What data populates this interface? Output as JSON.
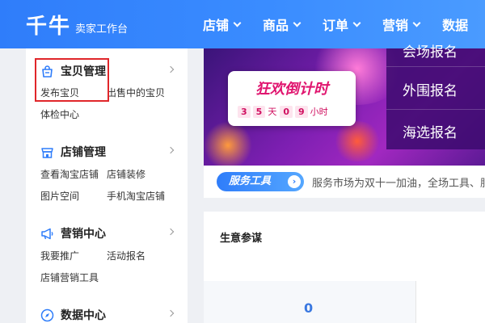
{
  "header": {
    "logo": "千牛",
    "subtitle": "卖家工作台",
    "nav": [
      {
        "label": "店铺"
      },
      {
        "label": "商品"
      },
      {
        "label": "订单"
      },
      {
        "label": "营销"
      },
      {
        "label": "数据"
      }
    ]
  },
  "sidebar": {
    "sections": [
      {
        "title": "宝贝管理",
        "icon": "bag-icon",
        "links": [
          "发布宝贝",
          "出售中的宝贝",
          "体检中心"
        ]
      },
      {
        "title": "店铺管理",
        "icon": "store-icon",
        "links": [
          "查看淘宝店铺",
          "店铺装修",
          "图片空间",
          "手机淘宝店铺"
        ]
      },
      {
        "title": "营销中心",
        "icon": "megaphone-icon",
        "links": [
          "我要推广",
          "活动报名",
          "店铺营销工具"
        ]
      },
      {
        "title": "数据中心",
        "icon": "compass-icon",
        "links": []
      }
    ]
  },
  "banner": {
    "promo_title": "狂欢倒计时",
    "countdown": {
      "d1": "3",
      "d2": "5",
      "day_unit": "天",
      "h1": "0",
      "h2": "9",
      "hour_unit": "小时"
    },
    "side_items": [
      "会场报名",
      "外围报名",
      "海选报名"
    ]
  },
  "notice": {
    "badge": "服务工具",
    "text": "服务市场为双十一加油，全场工具、服"
  },
  "business": {
    "title": "生意参谋",
    "value": "0"
  },
  "colors": {
    "header_blue": "#2f7dfa",
    "highlight_red": "#e0262a",
    "banner_purple": "#7d1fb2"
  }
}
